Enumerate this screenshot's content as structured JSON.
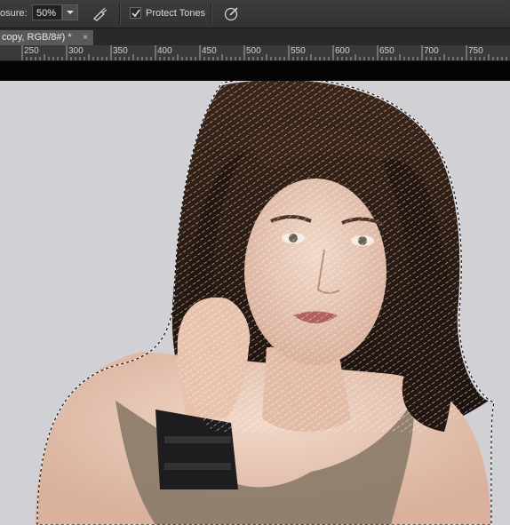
{
  "options_bar": {
    "exposure_label": "osure:",
    "exposure_value": "50%",
    "protect_tones_label": "Protect Tones",
    "protect_tones_checked": true
  },
  "tab": {
    "title": "copy, RGB/8#) *",
    "close": "×"
  },
  "ruler": {
    "labels": [
      "250",
      "300",
      "350",
      "400",
      "450",
      "500",
      "550",
      "600",
      "650",
      "700",
      "750"
    ]
  },
  "colors": {
    "ui_dark": "#323232",
    "canvas_bg": "#d1d0d5",
    "hair": "#2a1a12"
  }
}
